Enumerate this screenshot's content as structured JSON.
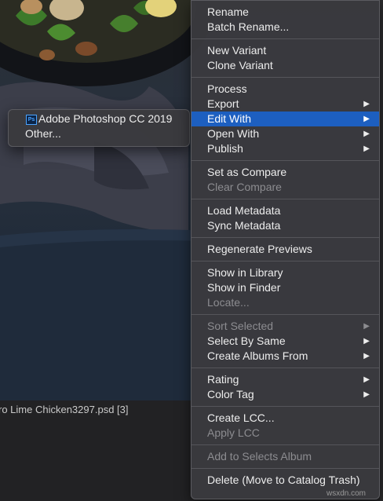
{
  "photo": {
    "caption": "ro Lime Chicken3297.psd [3]"
  },
  "context_menu": {
    "groups": [
      [
        {
          "label": "Rename"
        },
        {
          "label": "Batch Rename..."
        }
      ],
      [
        {
          "label": "New Variant"
        },
        {
          "label": "Clone Variant"
        }
      ],
      [
        {
          "label": "Process"
        },
        {
          "label": "Export",
          "submenu": true
        },
        {
          "label": "Edit With",
          "submenu": true,
          "highlighted": true
        },
        {
          "label": "Open With",
          "submenu": true
        },
        {
          "label": "Publish",
          "submenu": true
        }
      ],
      [
        {
          "label": "Set as Compare"
        },
        {
          "label": "Clear Compare",
          "disabled": true
        }
      ],
      [
        {
          "label": "Load Metadata"
        },
        {
          "label": "Sync Metadata"
        }
      ],
      [
        {
          "label": "Regenerate Previews"
        }
      ],
      [
        {
          "label": "Show in Library"
        },
        {
          "label": "Show in Finder"
        },
        {
          "label": "Locate...",
          "disabled": true
        }
      ],
      [
        {
          "label": "Sort Selected",
          "submenu": true,
          "disabled": true
        },
        {
          "label": "Select By Same",
          "submenu": true
        },
        {
          "label": "Create Albums From",
          "submenu": true
        }
      ],
      [
        {
          "label": "Rating",
          "submenu": true
        },
        {
          "label": "Color Tag",
          "submenu": true
        }
      ],
      [
        {
          "label": "Create LCC..."
        },
        {
          "label": "Apply LCC",
          "disabled": true
        }
      ],
      [
        {
          "label": "Add to Selects Album",
          "disabled": true
        }
      ],
      [
        {
          "label": "Delete (Move to Catalog Trash)"
        }
      ]
    ]
  },
  "edit_with_submenu": {
    "items": [
      {
        "label": "Adobe Photoshop CC 2019",
        "icon": "photoshop-icon",
        "icon_text": "Ps"
      },
      {
        "label": "Other..."
      }
    ]
  },
  "watermark": "wsxdn.com",
  "colors": {
    "menu_bg": "#3a3a3e",
    "highlight": "#1d5fc0",
    "disabled_text": "#8c8c90"
  }
}
